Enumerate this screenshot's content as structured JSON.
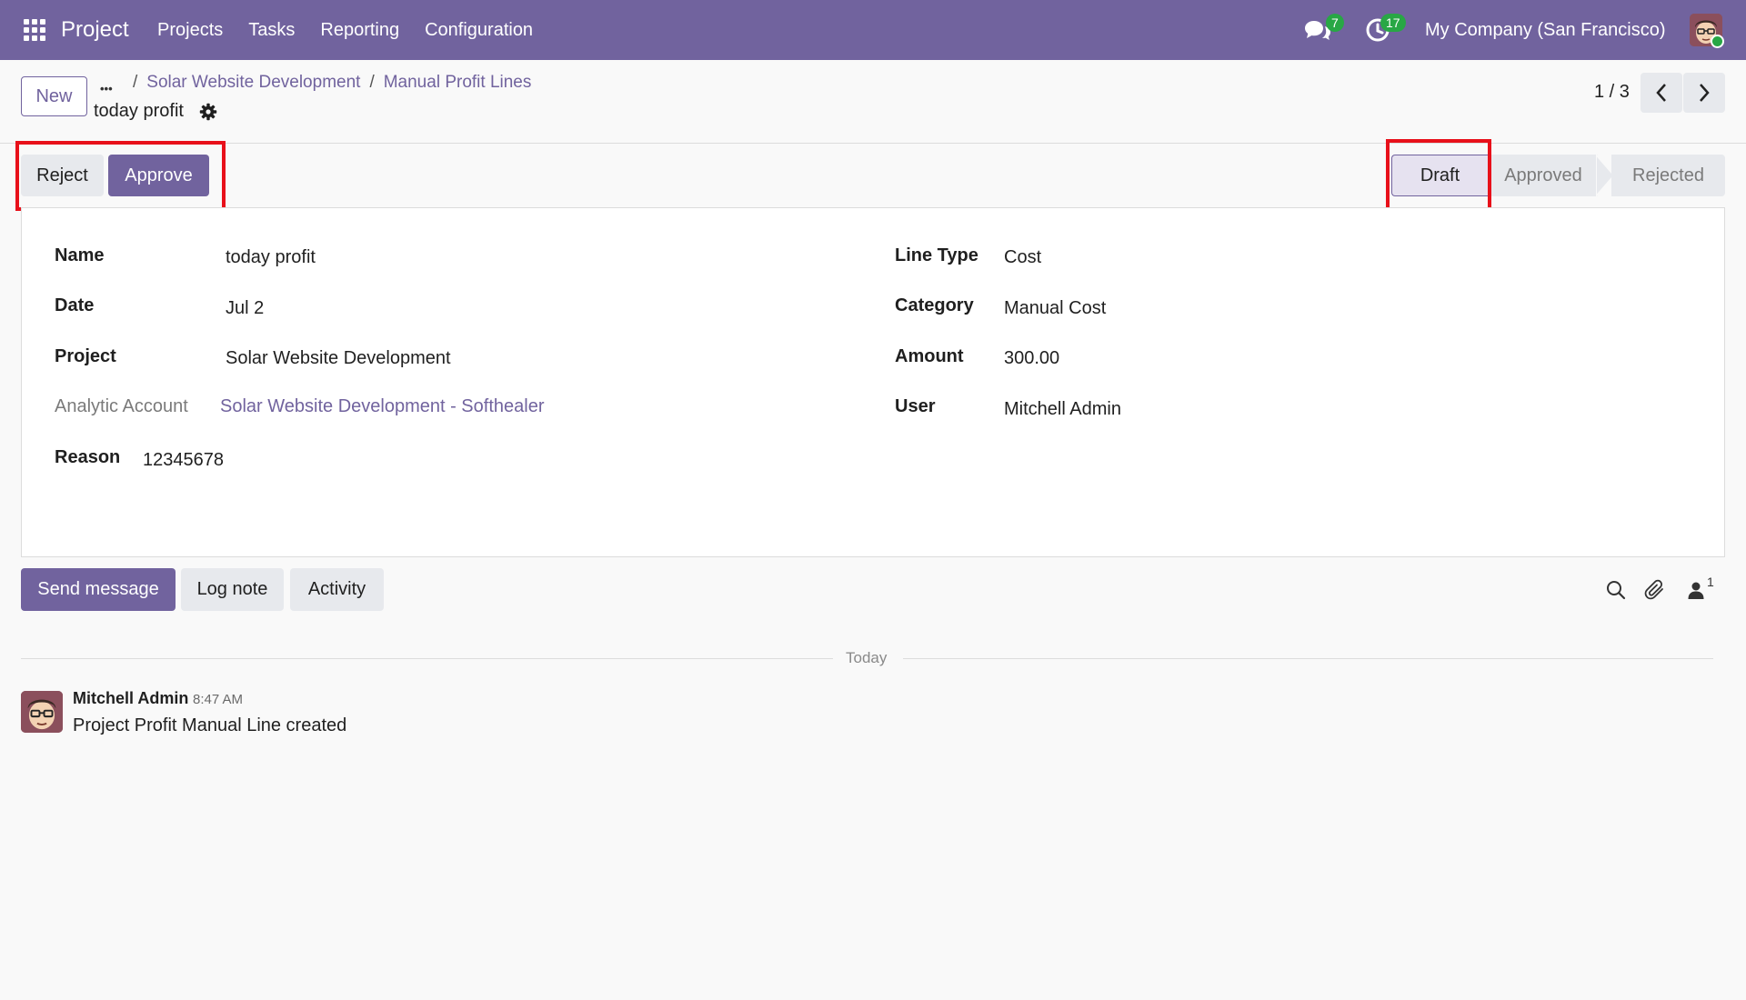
{
  "navbar": {
    "app_name": "Project",
    "menu": [
      "Projects",
      "Tasks",
      "Reporting",
      "Configuration"
    ],
    "messages_count": "7",
    "activities_count": "17",
    "company": "My Company (San Francisco)",
    "color": "#71639e"
  },
  "control_panel": {
    "new_label": "New",
    "more_label": "•••",
    "breadcrumbs": [
      "Solar Website Development",
      "Manual Profit Lines"
    ],
    "breadcrumb_sep": "/",
    "record_title": "today profit",
    "pager": "1 / 3"
  },
  "statusbar": {
    "reject_label": "Reject",
    "approve_label": "Approve",
    "stages": [
      "Draft",
      "Approved",
      "Rejected"
    ],
    "current_stage": "Draft"
  },
  "form": {
    "left": [
      {
        "label": "Name",
        "value": "today profit"
      },
      {
        "label": "Date",
        "value": "Jul 2"
      },
      {
        "label": "Project",
        "value": "Solar Website Development"
      },
      {
        "label": "Analytic Account",
        "value": "Solar Website Development - Softhealer"
      },
      {
        "label": "Reason",
        "value": "12345678"
      }
    ],
    "right": [
      {
        "label": "Line Type",
        "value": "Cost"
      },
      {
        "label": "Category",
        "value": "Manual Cost"
      },
      {
        "label": "Amount",
        "value": "300.00"
      },
      {
        "label": "User",
        "value": "Mitchell Admin"
      }
    ]
  },
  "chatter": {
    "send_message_label": "Send message",
    "log_note_label": "Log note",
    "activity_label": "Activity",
    "followers_count": "1",
    "date_separator": "Today",
    "messages": [
      {
        "author": "Mitchell Admin",
        "time": "8:47 AM",
        "body": "Project Profit Manual Line created"
      }
    ]
  }
}
